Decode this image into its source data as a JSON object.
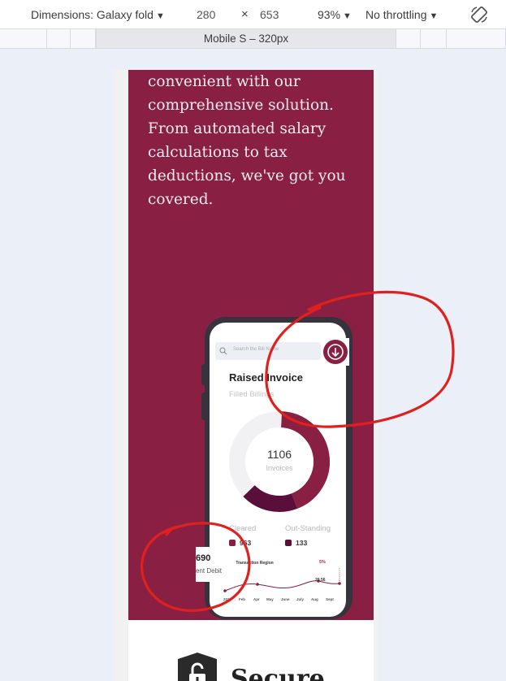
{
  "toolbar": {
    "dimensions_label": "Dimensions: Galaxy fold",
    "width": "280",
    "times": "×",
    "height": "653",
    "zoom": "93%",
    "throttling": "No throttling",
    "rotate_icon": "rotate-icon"
  },
  "ruler": {
    "active_label": "Mobile S – 320px"
  },
  "hero": {
    "lines": [
      "convenient with our",
      "comprehensive solution.",
      "From automated salary",
      "calculations to tax",
      "deductions, we've got you",
      "covered."
    ]
  },
  "phone": {
    "search_placeholder": "Search the Bill Name",
    "title": "Raised Invoice",
    "subtitle": "Filled Billings",
    "donut_value": "1106",
    "donut_label": "Invoices",
    "donut_fractions": {
      "cleared": 0.7,
      "outstanding": 0.3
    },
    "legend": [
      {
        "title": "Cleared",
        "value": "963",
        "color": "#8a1f44"
      },
      {
        "title": "Out-Standing",
        "value": "133",
        "color": "#5a0f3a"
      }
    ],
    "chart_title": "My Transaction Region",
    "chart_pct": "5%",
    "chart_peak": "20.56",
    "months": [
      "2021",
      "Feb",
      "Apr",
      "May",
      "June",
      "July",
      "Aug",
      "Sept"
    ]
  },
  "debit_card": {
    "amount": "690",
    "label": "ent Debit"
  },
  "bottom": {
    "heading": "Secure"
  },
  "colors": {
    "brand": "#8a1f44",
    "annotation": "#e0201c"
  }
}
